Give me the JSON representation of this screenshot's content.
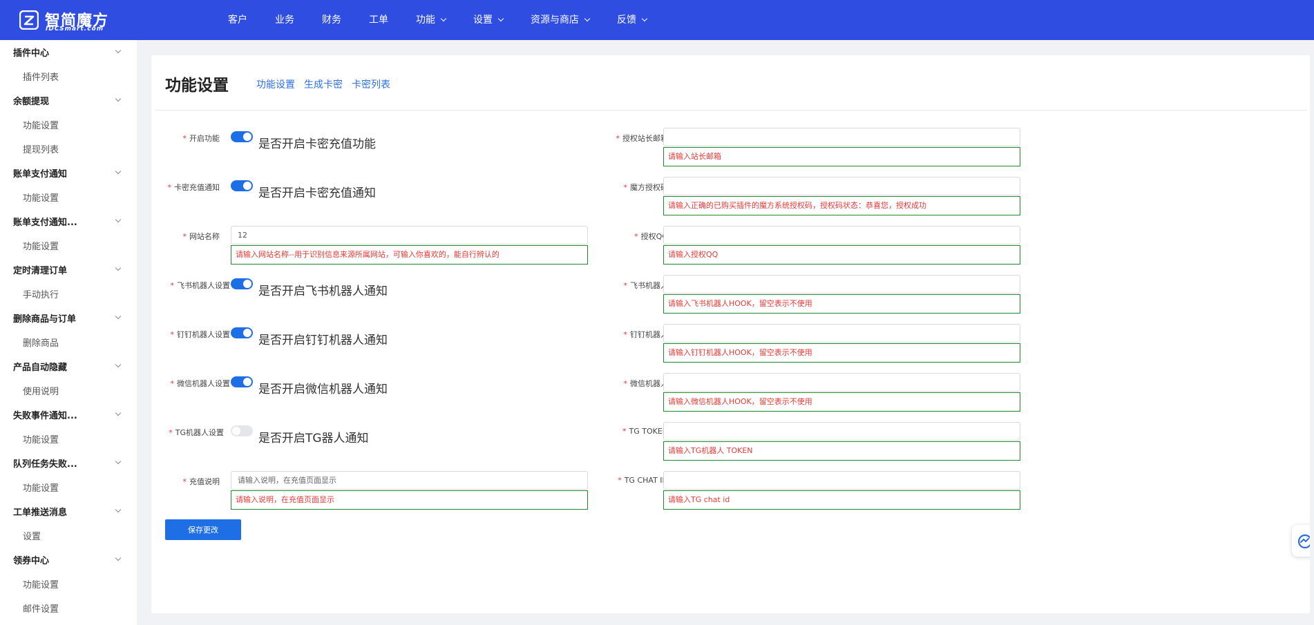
{
  "brand": {
    "title": "智简魔方",
    "subtitle": "IDCSmart.com"
  },
  "nav": [
    {
      "label": "客户",
      "dropdown": false
    },
    {
      "label": "业务",
      "dropdown": false
    },
    {
      "label": "财务",
      "dropdown": false
    },
    {
      "label": "工单",
      "dropdown": false
    },
    {
      "label": "功能",
      "dropdown": true
    },
    {
      "label": "设置",
      "dropdown": true
    },
    {
      "label": "资源与商店",
      "dropdown": true
    },
    {
      "label": "反馈",
      "dropdown": true
    }
  ],
  "sidebar": [
    {
      "label": "插件中心",
      "children": [
        "插件列表"
      ]
    },
    {
      "label": "余额提现",
      "children": [
        "功能设置",
        "提现列表"
      ]
    },
    {
      "label": "账单支付通知",
      "children": [
        "功能设置"
      ]
    },
    {
      "label": "账单支付通知...",
      "children": [
        "功能设置"
      ]
    },
    {
      "label": "定时清理订单",
      "children": [
        "手动执行"
      ]
    },
    {
      "label": "删除商品与订单",
      "children": [
        "删除商品"
      ]
    },
    {
      "label": "产品自动隐藏",
      "children": [
        "使用说明"
      ]
    },
    {
      "label": "失败事件通知...",
      "children": [
        "功能设置"
      ]
    },
    {
      "label": "队列任务失败...",
      "children": [
        "功能设置"
      ]
    },
    {
      "label": "工单推送消息",
      "children": [
        "设置"
      ]
    },
    {
      "label": "领券中心",
      "children": [
        "功能设置",
        "邮件设置"
      ]
    }
  ],
  "page": {
    "title": "功能设置",
    "tabs": [
      "功能设置",
      "生成卡密",
      "卡密列表"
    ]
  },
  "form_left": {
    "enable": {
      "label": "开启功能",
      "on": true,
      "text": "是否开启卡密充值功能"
    },
    "recharge_notify": {
      "label": "卡密充值通知",
      "on": true,
      "text": "是否开启卡密充值通知"
    },
    "site_name": {
      "label": "网站名称",
      "value": "12",
      "hint": "请输入网站名称--用于识别信息来源所属网站，可输入你喜欢的，能自行辨认的"
    },
    "feishu": {
      "label": "飞书机器人设置",
      "on": true,
      "text": "是否开启飞书机器人通知"
    },
    "dingtalk": {
      "label": "钉钉机器人设置",
      "on": true,
      "text": "是否开启钉钉机器人通知"
    },
    "wechat": {
      "label": "微信机器人设置",
      "on": true,
      "text": "是否开启微信机器人通知"
    },
    "tg": {
      "label": "TG机器人设置",
      "on": false,
      "text": "是否开启TG器人通知"
    },
    "desc": {
      "label": "充值说明",
      "placeholder": "请输入说明，在充值页面显示",
      "hint": "请输入说明，在充值页面显示"
    }
  },
  "form_right": [
    {
      "label": "授权站长邮箱",
      "value": "",
      "hint": "请输入站长邮箱"
    },
    {
      "label": "魔方授权码",
      "value": "",
      "hint": "请输入正确的已购买插件的魔方系统授权码，授权码状态：恭喜您，授权成功"
    },
    {
      "label": "授权QQ",
      "value": "",
      "hint": "请输入授权QQ"
    },
    {
      "label": "飞书机器人",
      "value": "",
      "hint": "请输入飞书机器人HOOK，留空表示不使用"
    },
    {
      "label": "钉钉机器人",
      "value": "",
      "hint": "请输入钉钉机器人HOOK，留空表示不使用"
    },
    {
      "label": "微信机器人",
      "value": "",
      "hint": "请输入微信机器人HOOK，留空表示不使用"
    },
    {
      "label": "TG TOKEN",
      "value": "",
      "hint": "请输入TG机器人 TOKEN"
    },
    {
      "label": "TG CHAT ID",
      "value": "",
      "hint": "请输入TG chat id"
    }
  ],
  "required_mark": "*",
  "save_button": "保存更改",
  "colors": {
    "topbar": "#2f4de1",
    "accent": "#1e6fe6",
    "hint_border": "#1f8c2a",
    "hint_text": "#e53935"
  }
}
